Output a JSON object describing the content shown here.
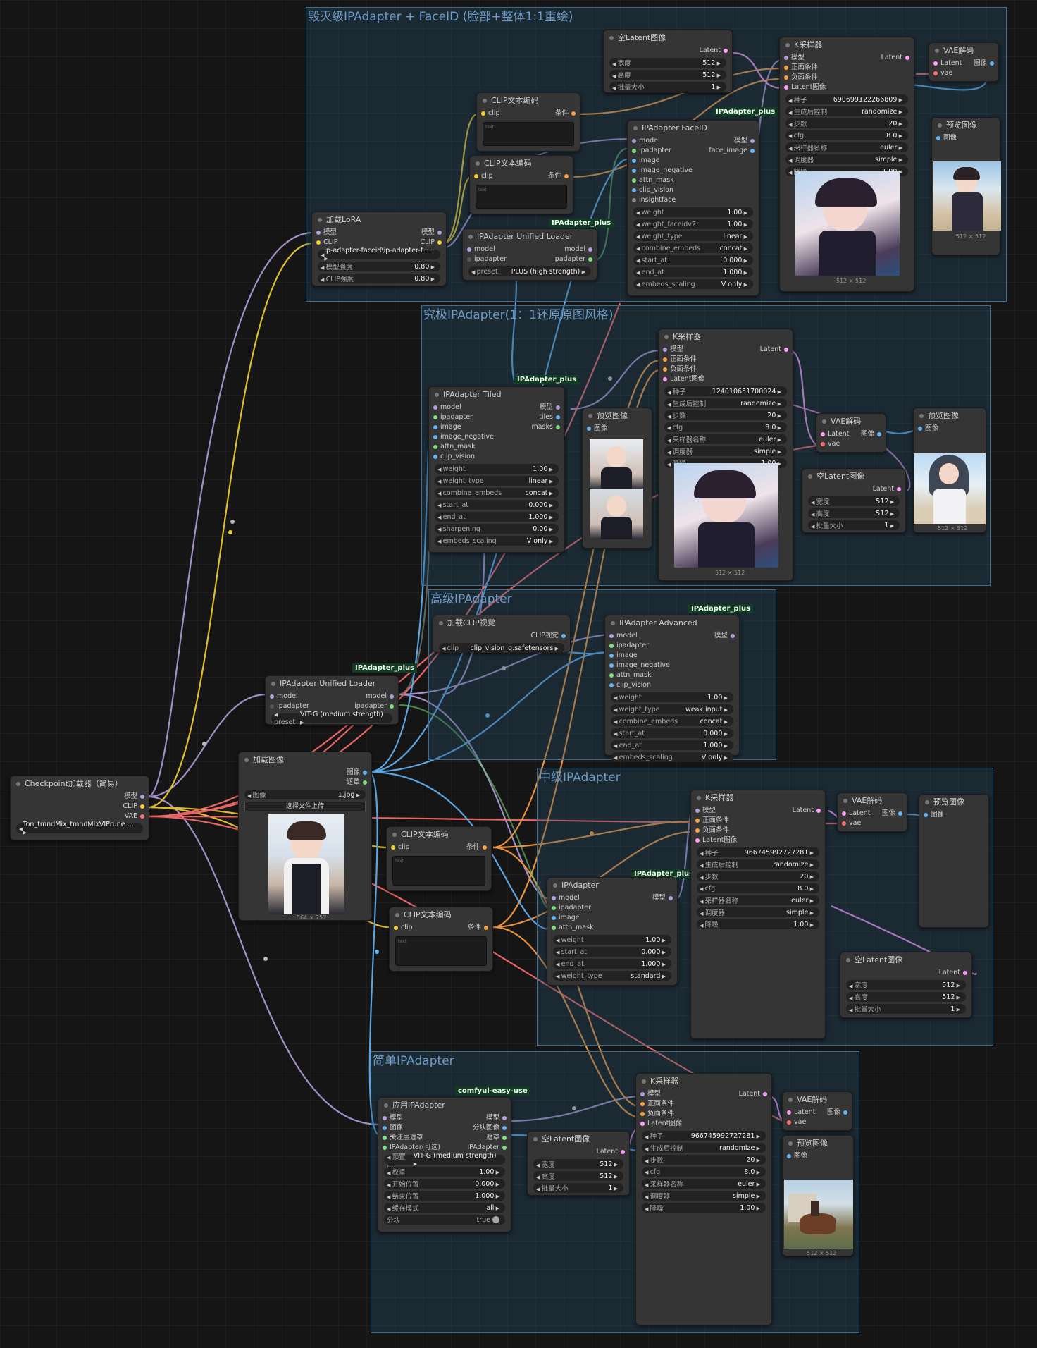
{
  "groups": [
    {
      "title": "毁灭级IPAdapter + FaceID (脸部+整体1:1重绘)"
    },
    {
      "title": "究极IPAdapter(1：1还原原图风格)"
    },
    {
      "title": "高级IPAdapter"
    },
    {
      "title": "中级IPAdapter"
    },
    {
      "title": "简单IPAdapter"
    }
  ],
  "badges": {
    "plus1": "IPAdapter_plus",
    "plus2": "IPAdapter_plus",
    "plus3": "IPAdapter_plus",
    "plus4": "IPAdapter_plus",
    "plus5": "IPAdapter_plus",
    "plus6": "IPAdapter_plus",
    "easy": "comfyui-easy-use"
  },
  "checkpoint": {
    "title": "Checkpoint加载器（简易）",
    "out_model": "模型",
    "out_clip": "CLIP",
    "out_vae": "VAE",
    "ckpt": "Ton_tmndMix_tmndMixVIPrune ..."
  },
  "lora": {
    "title": "加载LoRA",
    "in_model": "模型",
    "in_clip": "CLIP",
    "out_model": "模型",
    "out_clip": "CLIP",
    "name": "ip-adapter-faceid\\ip-adapter-f ...",
    "w1": "模型强度",
    "v1": "0.80",
    "w2": "CLIP强度",
    "v2": "0.80"
  },
  "clip1": {
    "title": "CLIP文本编码",
    "in": "clip",
    "out": "条件",
    "ph": "text"
  },
  "clip2": {
    "title": "CLIP文本编码",
    "in": "clip",
    "out": "条件",
    "ph": "text"
  },
  "clip3": {
    "title": "CLIP文本编码",
    "in": "clip",
    "out": "条件",
    "ph": "text"
  },
  "clip4": {
    "title": "CLIP文本编码",
    "in": "clip",
    "out": "条件",
    "ph": "text"
  },
  "unified1": {
    "title": "IPAdapter Unified Loader",
    "in1": "model",
    "in2": "ipadapter",
    "out1": "model",
    "out2": "ipadapter",
    "w": "preset",
    "v": "PLUS (high strength)"
  },
  "unified2": {
    "title": "IPAdapter Unified Loader",
    "in1": "model",
    "in2": "ipadapter",
    "out1": "model",
    "out2": "ipadapter",
    "w": "preset",
    "v": "VIT-G (medium strength)"
  },
  "latent1": {
    "title": "空Latent图像",
    "out": "Latent",
    "w1": "宽度",
    "v1": "512",
    "w2": "高度",
    "v2": "512",
    "w3": "批量大小",
    "v3": "1"
  },
  "latent2": {
    "title": "空Latent图像",
    "out": "Latent",
    "w1": "宽度",
    "v1": "512",
    "w2": "高度",
    "v2": "512",
    "w3": "批量大小",
    "v3": "1"
  },
  "latent3": {
    "title": "空Latent图像",
    "out": "Latent",
    "w1": "宽度",
    "v1": "512",
    "w2": "高度",
    "v2": "512",
    "w3": "批量大小",
    "v3": "1"
  },
  "latent4": {
    "title": "空Latent图像",
    "out": "Latent",
    "w1": "宽度",
    "v1": "512",
    "w2": "高度",
    "v2": "512",
    "w3": "批量大小",
    "v3": "1"
  },
  "faceid": {
    "title": "IPAdapter FaceID",
    "inputs": [
      "model",
      "ipadapter",
      "image",
      "image_negative",
      "attn_mask",
      "clip_vision",
      "insightface"
    ],
    "out1": "模型",
    "out2": "face_image",
    "widgets": [
      [
        "weight",
        "1.00"
      ],
      [
        "weight_faceidv2",
        "1.00"
      ],
      [
        "weight_type",
        "linear"
      ],
      [
        "combine_embeds",
        "concat"
      ],
      [
        "start_at",
        "0.000"
      ],
      [
        "end_at",
        "1.000"
      ],
      [
        "embeds_scaling",
        "V only"
      ]
    ]
  },
  "ks1": {
    "title": "K采样器",
    "in": [
      "模型",
      "正面条件",
      "负面条件",
      "Latent图像"
    ],
    "out": "Latent",
    "widgets": [
      [
        "种子",
        "690699122266809"
      ],
      [
        "生成后控制",
        "randomize"
      ],
      [
        "步数",
        "20"
      ],
      [
        "cfg",
        "8.0"
      ],
      [
        "采样器名称",
        "euler"
      ],
      [
        "调度器",
        "simple"
      ],
      [
        "降噪",
        "1.00"
      ]
    ],
    "cap": "512 × 512"
  },
  "ks2": {
    "title": "K采样器",
    "in": [
      "模型",
      "正面条件",
      "负面条件",
      "Latent图像"
    ],
    "out": "Latent",
    "widgets": [
      [
        "种子",
        "124010651700024"
      ],
      [
        "生成后控制",
        "randomize"
      ],
      [
        "步数",
        "20"
      ],
      [
        "cfg",
        "8.0"
      ],
      [
        "采样器名称",
        "euler"
      ],
      [
        "调度器",
        "simple"
      ],
      [
        "降噪",
        "1.00"
      ]
    ],
    "cap": "512 × 512"
  },
  "ks3": {
    "title": "K采样器",
    "in": [
      "模型",
      "正面条件",
      "负面条件",
      "Latent图像"
    ],
    "out": "Latent",
    "widgets": [
      [
        "种子",
        "966745992727281"
      ],
      [
        "生成后控制",
        "randomize"
      ],
      [
        "步数",
        "20"
      ],
      [
        "cfg",
        "8.0"
      ],
      [
        "采样器名称",
        "euler"
      ],
      [
        "调度器",
        "simple"
      ],
      [
        "降噪",
        "1.00"
      ]
    ]
  },
  "ks4": {
    "title": "K采样器",
    "in": [
      "模型",
      "正面条件",
      "负面条件",
      "Latent图像"
    ],
    "out": "Latent",
    "widgets": [
      [
        "种子",
        "966745992727281"
      ],
      [
        "生成后控制",
        "randomize"
      ],
      [
        "步数",
        "20"
      ],
      [
        "cfg",
        "8.0"
      ],
      [
        "采样器名称",
        "euler"
      ],
      [
        "调度器",
        "simple"
      ],
      [
        "降噪",
        "1.00"
      ]
    ]
  },
  "vae1": {
    "title": "VAE解码",
    "in1": "Latent",
    "in2": "vae",
    "out": "图像"
  },
  "vae2": {
    "title": "VAE解码",
    "in1": "Latent",
    "in2": "vae",
    "out": "图像"
  },
  "vae3": {
    "title": "VAE解码",
    "in1": "Latent",
    "in2": "vae",
    "out": "图像"
  },
  "vae4": {
    "title": "VAE解码",
    "in1": "Latent",
    "in2": "vae",
    "out": "图像"
  },
  "prev1": {
    "title": "预览图像",
    "in": "图像",
    "cap": "512 × 512"
  },
  "prev2": {
    "title": "预览图像",
    "in": "图像",
    "cap": "512 × 512"
  },
  "prev3": {
    "title": "预览图像",
    "in": "图像"
  },
  "prev4": {
    "title": "预览图像",
    "in": "图像",
    "cap": "512 × 512"
  },
  "prev_tiles": {
    "title": "预览图像",
    "in": "图像"
  },
  "tiled": {
    "title": "IPAdapter Tiled",
    "inputs": [
      "model",
      "ipadapter",
      "image",
      "image_negative",
      "attn_mask",
      "clip_vision"
    ],
    "outs": [
      "模型",
      "tiles",
      "masks"
    ],
    "widgets": [
      [
        "weight",
        "1.00"
      ],
      [
        "weight_type",
        "linear"
      ],
      [
        "combine_embeds",
        "concat"
      ],
      [
        "start_at",
        "0.000"
      ],
      [
        "end_at",
        "1.000"
      ],
      [
        "sharpening",
        "0.00"
      ],
      [
        "embeds_scaling",
        "V only"
      ]
    ]
  },
  "clipvision": {
    "title": "加载CLIP视觉",
    "out": "CLIP视觉",
    "w": "clip",
    "v": "clip_vision_g.safetensors"
  },
  "advanced": {
    "title": "IPAdapter Advanced",
    "inputs": [
      "model",
      "ipadapter",
      "image",
      "image_negative",
      "attn_mask",
      "clip_vision"
    ],
    "out": "模型",
    "widgets": [
      [
        "weight",
        "1.00"
      ],
      [
        "weight_type",
        "weak input"
      ],
      [
        "combine_embeds",
        "concat"
      ],
      [
        "start_at",
        "0.000"
      ],
      [
        "end_at",
        "1.000"
      ],
      [
        "embeds_scaling",
        "V only"
      ]
    ]
  },
  "loadimg": {
    "title": "加载图像",
    "out1": "图像",
    "out2": "遮罩",
    "w": "图像",
    "v": "1.jpg",
    "btn": "选择文件上传",
    "cap": "564 × 752"
  },
  "ipa": {
    "title": "IPAdapter",
    "inputs": [
      "model",
      "ipadapter",
      "image",
      "attn_mask"
    ],
    "out": "模型",
    "widgets": [
      [
        "weight",
        "1.00"
      ],
      [
        "start_at",
        "0.000"
      ],
      [
        "end_at",
        "1.000"
      ],
      [
        "weight_type",
        "standard"
      ]
    ]
  },
  "apply": {
    "title": "应用IPAdapter",
    "inputs": [
      "模型",
      "图像",
      "关注层遮罩",
      "IPAdapter(可选)"
    ],
    "outs": [
      "模型",
      "分块图像",
      "遮罩",
      "IPAdapter"
    ],
    "widgets": [
      [
        "预置 ...",
        "VIT-G (medium strength)"
      ],
      [
        "权重",
        "1.00"
      ],
      [
        "开始位置",
        "0.000"
      ],
      [
        "结束位置",
        "1.000"
      ],
      [
        "缓存模式",
        "all"
      ]
    ],
    "toggle_label": "分块",
    "toggle_val": "true"
  },
  "colors": {
    "model": "#b39ddb",
    "clip": "#f5d130",
    "vae": "#ff6e6e",
    "cond": "#ffa040",
    "latent": "#ff9cf9",
    "image": "#64b5f6",
    "ipadapter": "#7ee07e",
    "group_border": "#3a6f93"
  }
}
